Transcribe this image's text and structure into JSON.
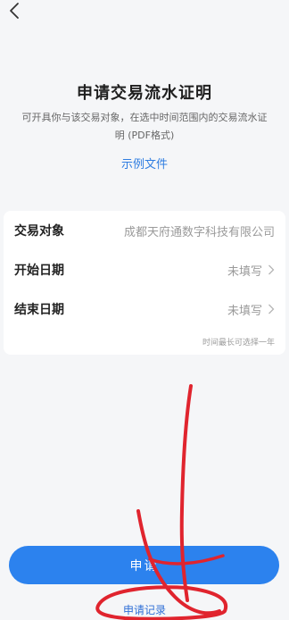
{
  "nav": {
    "back_icon": "chevron-left-icon"
  },
  "header": {
    "title": "申请交易流水证明",
    "subtitle": "可开具你与该交易对象，在选中时间范围内的交易流水证明 (PDF格式)",
    "example_link": "示例文件"
  },
  "form": {
    "rows": [
      {
        "label": "交易对象",
        "value": "成都天府通数字科技有限公司"
      },
      {
        "label": "开始日期",
        "value": "未填写"
      },
      {
        "label": "结束日期",
        "value": "未填写"
      }
    ],
    "hint": "时间最长可选择一年"
  },
  "footer": {
    "submit_label": "申请",
    "records_label": "申请记录"
  },
  "colors": {
    "accent": "#2c82ee",
    "link": "#2f7de1",
    "annotation": "#e0242e"
  }
}
